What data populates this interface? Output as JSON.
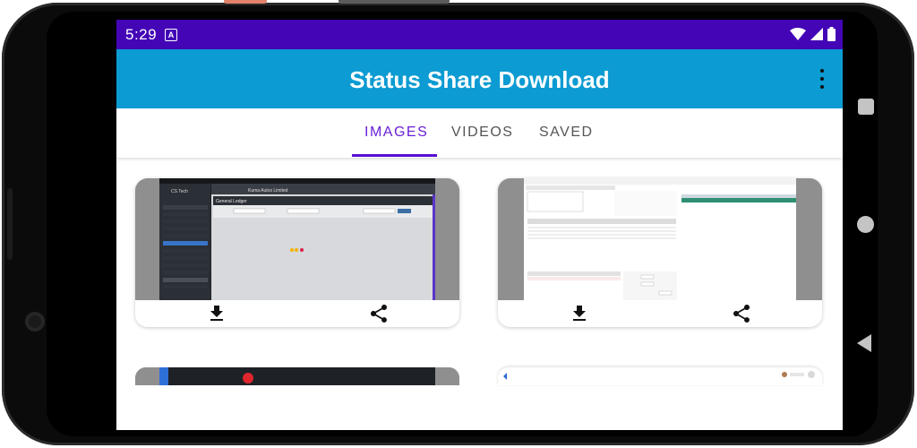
{
  "status_bar": {
    "time": "5:29",
    "notification_icon": "A"
  },
  "app_bar": {
    "title": "Status Share Download"
  },
  "tabs": [
    {
      "label": "IMAGES",
      "active": true
    },
    {
      "label": "VIDEOS",
      "active": false
    },
    {
      "label": "SAVED",
      "active": false
    }
  ],
  "cards": [
    {
      "thumbnail": "ledger-screenshot",
      "app_name": "CS Tech",
      "company": "Kuma Autos Limited",
      "page_heading": "General Ledger",
      "download_icon": "download-icon",
      "share_icon": "share-icon"
    },
    {
      "thumbnail": "invoice-screenshot",
      "download_icon": "download-icon",
      "share_icon": "share-icon"
    }
  ],
  "colors": {
    "status_bar": "#4305b6",
    "app_bar": "#0c9bd2",
    "tab_active": "#6a1fd8",
    "tab_indicator": "#5a0fd2"
  }
}
